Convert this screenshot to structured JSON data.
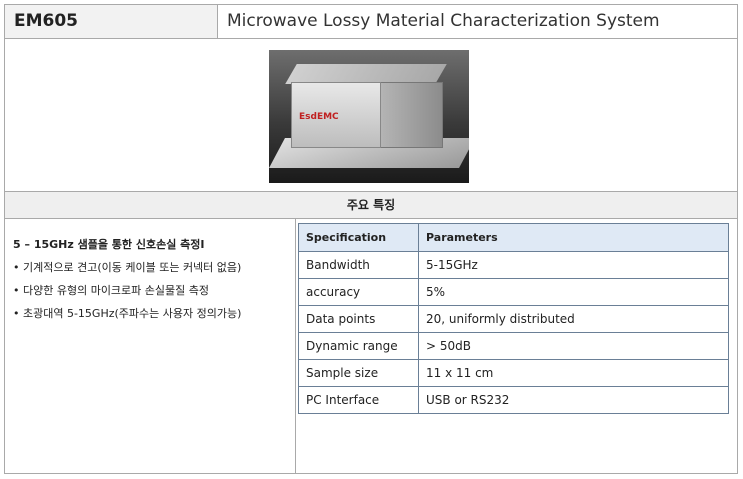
{
  "header": {
    "model": "EM605",
    "product_name": "Microwave Lossy Material Characterization System"
  },
  "photo": {
    "logo_text": "EsdEMC"
  },
  "features": {
    "section_title": "주요 특징",
    "headline": "5 – 15GHz 샘플을 통한 신호손실 측정I",
    "items": [
      "• 기계적으로 견고(이동 케이블 또는 커넥터 없음)",
      "• 다양한 유형의 마이크로파 손실물질 측정",
      "• 초광대역 5-15GHz(주파수는 사용자 정의가능)"
    ]
  },
  "spec_table": {
    "headers": [
      "Specification",
      "Parameters"
    ],
    "rows": [
      [
        "Bandwidth",
        "5-15GHz"
      ],
      [
        "accuracy",
        "5%"
      ],
      [
        "Data points",
        "20, uniformly distributed"
      ],
      [
        "Dynamic range",
        "> 50dB"
      ],
      [
        "Sample size",
        "11 x 11 cm"
      ],
      [
        "PC Interface",
        "USB or RS232"
      ]
    ]
  }
}
